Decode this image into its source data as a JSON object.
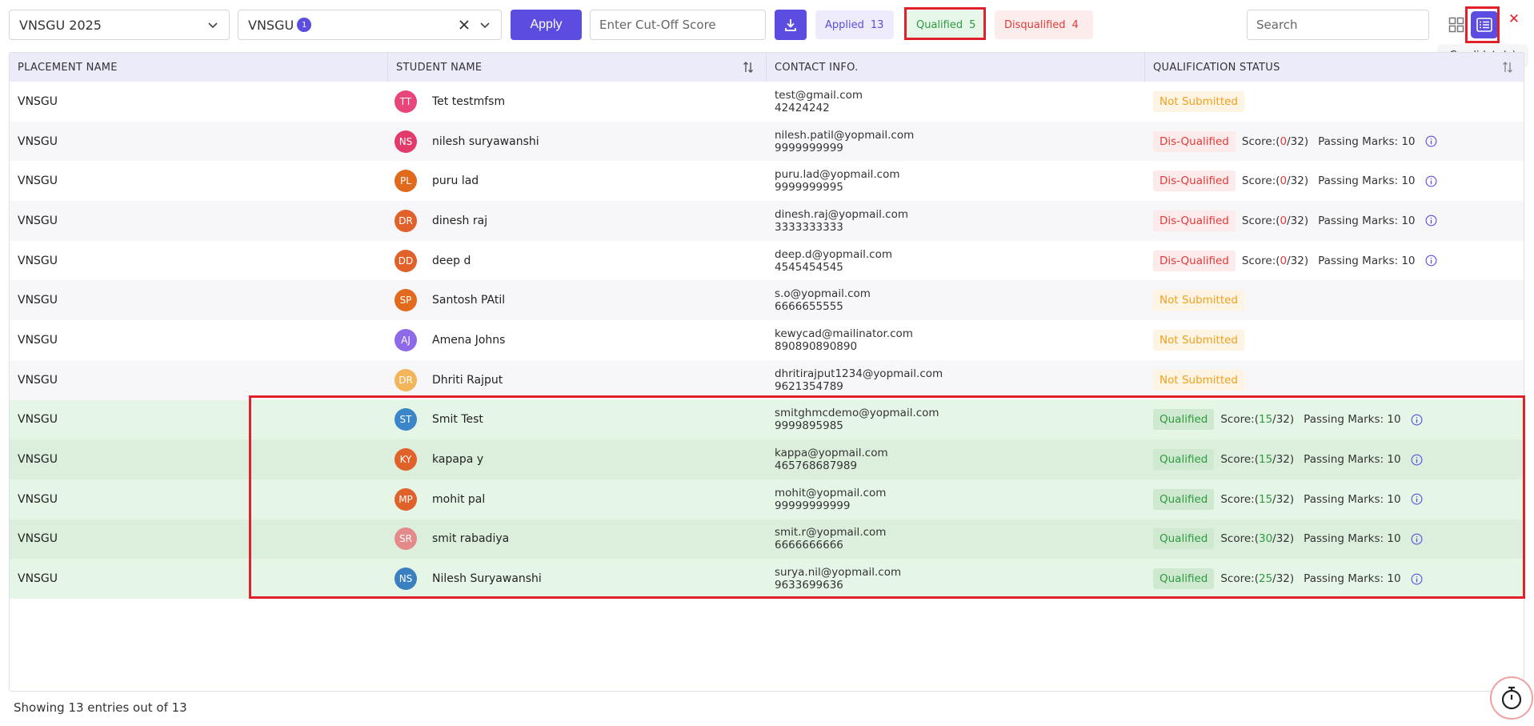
{
  "toolbar": {
    "placement_select": "VNSGU 2025",
    "college_select": "VNSGU",
    "college_count": "1",
    "apply_label": "Apply",
    "cutoff_placeholder": "Enter Cut-Off Score",
    "applied_label": "Applied",
    "applied_count": "13",
    "qualified_label": "Qualified",
    "qualified_count": "5",
    "disqualified_label": "Disqualified",
    "disqualified_count": "4",
    "search_placeholder": "Search",
    "tooltip": "Candidate(s)",
    "close_glyph": "✕"
  },
  "table": {
    "headers": [
      "PLACEMENT NAME",
      "STUDENT NAME",
      "CONTACT INFO.",
      "QUALIFICATION STATUS"
    ],
    "rows": [
      {
        "placement": "VNSGU",
        "initials": "TT",
        "avatar_color": "#e8457a",
        "name": "Tet testmfsm",
        "email": "test@gmail.com",
        "phone": "42424242",
        "status": "Not Submitted",
        "type": "ns"
      },
      {
        "placement": "VNSGU",
        "initials": "NS",
        "avatar_color": "#e23b6b",
        "name": "nilesh suryawanshi",
        "email": "nilesh.patil@yopmail.com",
        "phone": "9999999999",
        "status": "Dis-Qualified",
        "type": "dq",
        "score_prefix": "Score:(",
        "score": "0",
        "score_suffix": "/32)",
        "passing": "Passing Marks: 10"
      },
      {
        "placement": "VNSGU",
        "initials": "PL",
        "avatar_color": "#e26a1c",
        "name": "puru lad",
        "email": "puru.lad@yopmail.com",
        "phone": "9999999995",
        "status": "Dis-Qualified",
        "type": "dq",
        "score_prefix": "Score:(",
        "score": "0",
        "score_suffix": "/32)",
        "passing": "Passing Marks: 10"
      },
      {
        "placement": "VNSGU",
        "initials": "DR",
        "avatar_color": "#e0612a",
        "name": "dinesh raj",
        "email": "dinesh.raj@yopmail.com",
        "phone": "3333333333",
        "status": "Dis-Qualified",
        "type": "dq",
        "score_prefix": "Score:(",
        "score": "0",
        "score_suffix": "/32)",
        "passing": "Passing Marks: 10"
      },
      {
        "placement": "VNSGU",
        "initials": "DD",
        "avatar_color": "#e0612a",
        "name": "deep d",
        "email": "deep.d@yopmail.com",
        "phone": "4545454545",
        "status": "Dis-Qualified",
        "type": "dq",
        "score_prefix": "Score:(",
        "score": "0",
        "score_suffix": "/32)",
        "passing": "Passing Marks: 10"
      },
      {
        "placement": "VNSGU",
        "initials": "SP",
        "avatar_color": "#e26a1c",
        "name": "Santosh PAtil",
        "email": "s.o@yopmail.com",
        "phone": "6666655555",
        "status": "Not Submitted",
        "type": "ns"
      },
      {
        "placement": "VNSGU",
        "initials": "AJ",
        "avatar_color": "#8e6ae8",
        "name": "Amena Johns",
        "email": "kewycad@mailinator.com",
        "phone": "890890890890",
        "status": "Not Submitted",
        "type": "ns"
      },
      {
        "placement": "VNSGU",
        "initials": "DR",
        "avatar_color": "#f2b55a",
        "name": "Dhriti Rajput",
        "email": "dhritirajput1234@yopmail.com",
        "phone": "9621354789",
        "status": "Not Submitted",
        "type": "ns"
      },
      {
        "placement": "VNSGU",
        "initials": "ST",
        "avatar_color": "#3a86c8",
        "name": "Smit Test",
        "email": "smitghmcdemo@yopmail.com",
        "phone": "9999895985",
        "status": "Qualified",
        "type": "qq",
        "score_prefix": "Score:(",
        "score": "15",
        "score_suffix": "/32)",
        "passing": "Passing Marks: 10"
      },
      {
        "placement": "VNSGU",
        "initials": "KY",
        "avatar_color": "#e0612a",
        "name": "kapapa y",
        "email": "kappa@yopmail.com",
        "phone": "465768687989",
        "status": "Qualified",
        "type": "qq",
        "score_prefix": "Score:(",
        "score": "15",
        "score_suffix": "/32)",
        "passing": "Passing Marks: 10"
      },
      {
        "placement": "VNSGU",
        "initials": "MP",
        "avatar_color": "#e0612a",
        "name": "mohit pal",
        "email": "mohit@yopmail.com",
        "phone": "99999999999",
        "status": "Qualified",
        "type": "qq",
        "score_prefix": "Score:(",
        "score": "15",
        "score_suffix": "/32)",
        "passing": "Passing Marks: 10"
      },
      {
        "placement": "VNSGU",
        "initials": "SR",
        "avatar_color": "#e48a8a",
        "name": "smit rabadiya",
        "email": "smit.r@yopmail.com",
        "phone": "6666666666",
        "status": "Qualified",
        "type": "qq",
        "score_prefix": "Score:(",
        "score": "30",
        "score_suffix": "/32)",
        "passing": "Passing Marks: 10"
      },
      {
        "placement": "VNSGU",
        "initials": "NS",
        "avatar_color": "#3a7fc0",
        "name": "Nilesh Suryawanshi",
        "email": "surya.nil@yopmail.com",
        "phone": "9633699636",
        "status": "Qualified",
        "type": "qq",
        "score_prefix": "Score:(",
        "score": "25",
        "score_suffix": "/32)",
        "passing": "Passing Marks: 10"
      }
    ]
  },
  "footer": {
    "summary": "Showing 13 entries out of 13"
  },
  "colors": {
    "accent": "#5b4de0",
    "highlight": "#e0202a"
  }
}
